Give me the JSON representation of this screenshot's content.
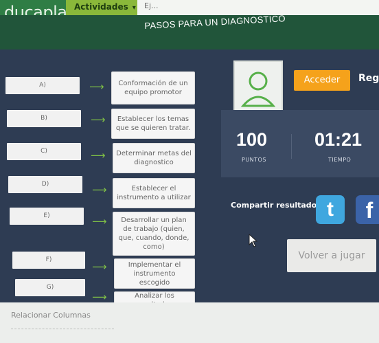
{
  "header": {
    "logo": "ducaplay",
    "nav_active": "Actividades",
    "nav_next": "Ej..."
  },
  "activity": {
    "title": "PASOS PARA UN DIAGNOSTICO",
    "rows": [
      {
        "letter": "A)",
        "answer": "Conformación de un equipo promotor"
      },
      {
        "letter": "B)",
        "answer": "Establecer los temas que se quieren tratar."
      },
      {
        "letter": "C)",
        "answer": "Determinar metas del diagnostico"
      },
      {
        "letter": "D)",
        "answer": "Establecer el instrumento a utilizar"
      },
      {
        "letter": "E)",
        "answer": "Desarrollar un plan de trabajo (quien, que, cuando, donde, como)"
      },
      {
        "letter": "F)",
        "answer": "Implementar el instrumento escogido"
      },
      {
        "letter": "G)",
        "answer": "Analizar los resultados"
      }
    ],
    "arrow": "⟶"
  },
  "user": {
    "login_label": "Acceder",
    "register_label": "Regi"
  },
  "score": {
    "points_value": "100",
    "points_label": "PUNTOS",
    "time_value": "01:21",
    "time_label": "TIEMPO"
  },
  "share": {
    "label": "Compartir resultado:",
    "twitter_glyph": "t",
    "facebook_glyph": "f"
  },
  "replay_label": "Volver a jugar",
  "footer": {
    "label": "Relacionar Columnas"
  },
  "colors": {
    "accent_green": "#2f7d45",
    "panel": "#2e3c53",
    "login_orange": "#f5a21b"
  }
}
